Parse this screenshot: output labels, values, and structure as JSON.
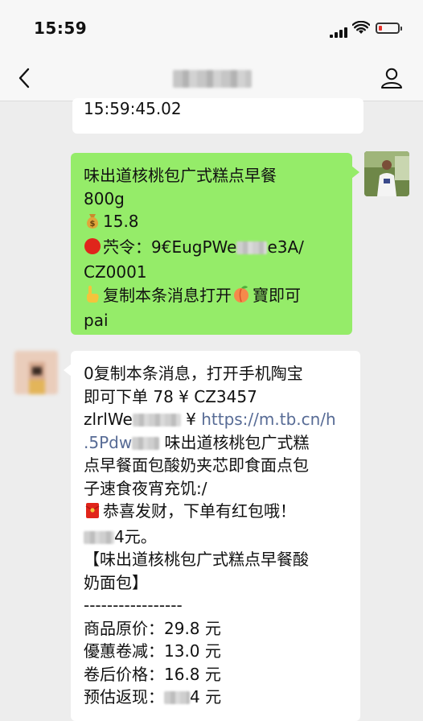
{
  "status_bar": {
    "time": "15:59"
  },
  "nav": {
    "title_blurred": true
  },
  "messages": {
    "top_partial": "15:59:45.02",
    "green": {
      "line1": "味出道核桃包广式糕点早餐",
      "line2": "800g",
      "price": "15.8",
      "code_prefix": "🔴",
      "code_label": "茓令：",
      "code_start": "9€EugPWe",
      "code_end": "e3A/",
      "code_line2": "CZ0001",
      "copy_text_a": "复制本条消息打开",
      "copy_text_b": "寶即可",
      "copy_text_c": "pai"
    },
    "long": {
      "l1": "0复制本条消息，打开手机陶宝",
      "l2": "即可下单 78 ¥  CZ3457",
      "l3_a": "zlrlWe",
      "l3_b": " ¥ ",
      "l3_link": "https://m.tb.cn/h",
      "l4_link": ".5Pdw",
      "l4_rest": "  味出道核桃包广式糕",
      "l5": "点早餐面包酸奶夹芯即食面点包",
      "l6": "子速食夜宵充饥:/",
      "l7": "恭喜发财，下单有红包哦！",
      "l8_tail": "4元。",
      "l9": "【味出道核桃包广式糕点早餐酸",
      "l10": "奶面包】",
      "l11": "-----------------",
      "l12": "商品原价：29.8 元",
      "l13": "優蕙卷减：13.0 元",
      "l14": "卷后价格：16.8 元",
      "l15_a": "预估返现：",
      "l15_b": "4 元"
    }
  },
  "colors": {
    "green_bubble": "#95ec69",
    "link": "#576b95",
    "background": "#ededed"
  }
}
